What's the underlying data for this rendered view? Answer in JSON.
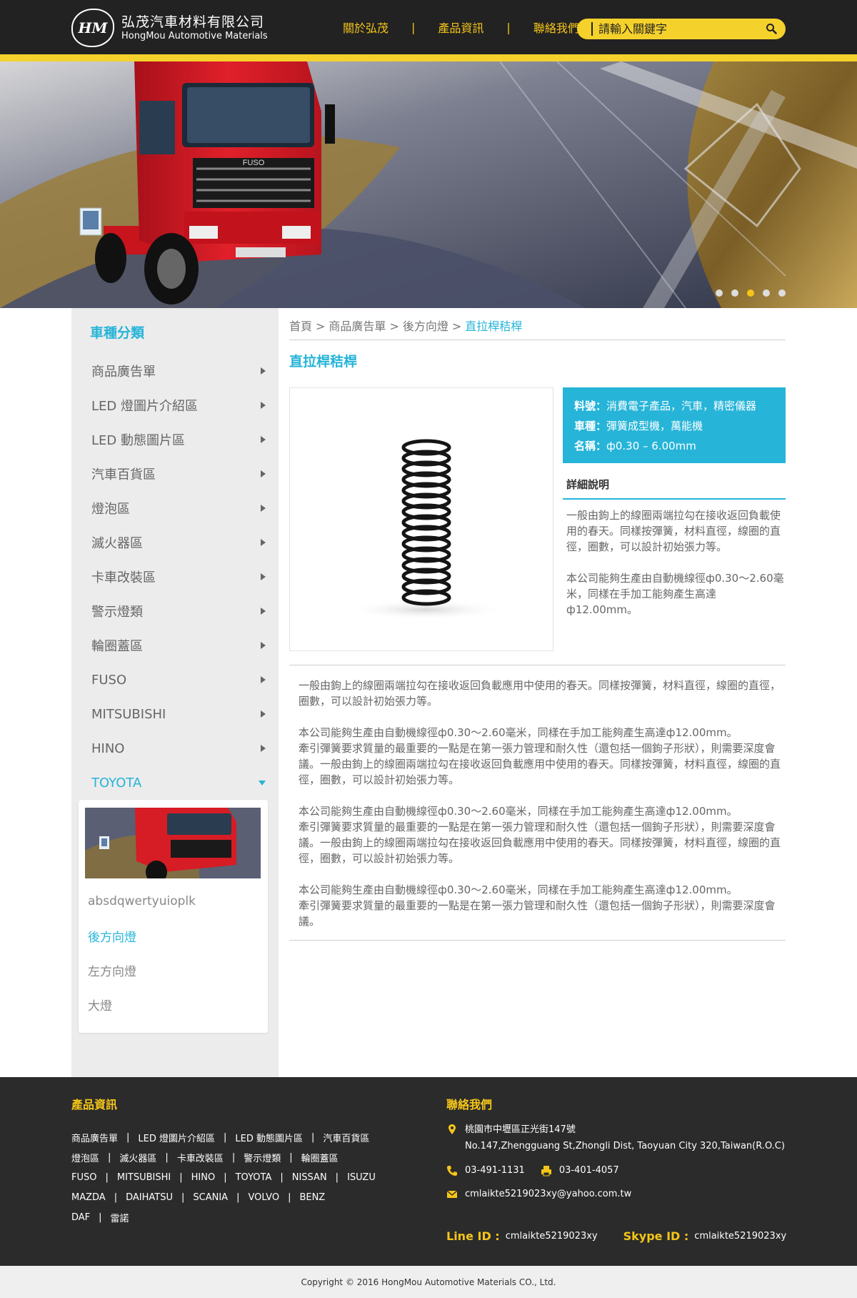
{
  "header": {
    "logo_mark": "HM",
    "company_cn": "弘茂汽車材料有限公司",
    "company_en": "HongMou Automotive Materials",
    "nav": [
      "關於弘茂",
      "產品資訊",
      "聯絡我們"
    ],
    "nav_separator": "|",
    "search_placeholder": "請輸入關鍵字"
  },
  "hero": {
    "truck_badge": "FUSO",
    "slides": 5,
    "active_slide": 3
  },
  "sidebar": {
    "title": "車種分類",
    "categories": [
      {
        "label": "商品廣告單"
      },
      {
        "label": "LED 燈圖片介紹區"
      },
      {
        "label": "LED 動態圖片區"
      },
      {
        "label": "汽車百貨區"
      },
      {
        "label": "燈泡區"
      },
      {
        "label": "滅火器區"
      },
      {
        "label": "卡車改裝區"
      },
      {
        "label": "警示燈類"
      },
      {
        "label": "輪圈蓋區"
      },
      {
        "label": "FUSO"
      },
      {
        "label": "MITSUBISHI"
      },
      {
        "label": "HINO"
      },
      {
        "label": "TOYOTA",
        "active": true
      }
    ],
    "sub_items": [
      {
        "label": "absdqwertyuioplk"
      },
      {
        "label": "後方向燈",
        "active": true
      },
      {
        "label": "左方向燈"
      },
      {
        "label": "大燈"
      }
    ]
  },
  "breadcrumb": {
    "items": [
      "首頁",
      "商品廣告單",
      "後方向燈"
    ],
    "current": "直拉桿秸桿",
    "separator": ">"
  },
  "product": {
    "title": "直拉桿秸桿",
    "fields": [
      {
        "label": "料號：",
        "value": "消費電子產品，汽車，精密儀器"
      },
      {
        "label": "車種：",
        "value": "彈簧成型機，萬能機"
      },
      {
        "label": "名稱：",
        "value": "ф0.30 – 6.00mm"
      }
    ],
    "detail_title": "詳細說明",
    "detail_paragraphs": [
      "一般由鉤上的線圈兩端拉勾在接收返回負載使用的春天。同樣按彈簧，材料直徑，線圈的直徑，圈數，可以設計初始張力等。",
      "本公司能夠生產由自動機線徑ф0.30～2.60毫米，同樣在手加工能夠產生高達ф12.00mm。"
    ],
    "description": [
      "一般由鉤上的線圈兩端拉勾在接收返回負載應用中使用的春天。同樣按彈簧，材料直徑，線圈的直徑，圈數，可以設計初始張力等。",
      "本公司能夠生產由自動機線徑ф0.30～2.60毫米，同樣在手加工能夠產生高達ф12.00mm。\n牽引彈簧要求質量的最重要的一點是在第一張力管理和耐久性（還包括一個鉤子形狀），則需要深度會議。一般由鉤上的線圈兩端拉勾在接收返回負載應用中使用的春天。同樣按彈簧，材料直徑，線圈的直徑，圈數，可以設計初始張力等。",
      "本公司能夠生產由自動機線徑ф0.30～2.60毫米，同樣在手加工能夠產生高達ф12.00mm。\n牽引彈簧要求質量的最重要的一點是在第一張力管理和耐久性（還包括一個鉤子形狀），則需要深度會議。一般由鉤上的線圈兩端拉勾在接收返回負載應用中使用的春天。同樣按彈簧，材料直徑，線圈的直徑，圈數，可以設計初始張力等。",
      "本公司能夠生產由自動機線徑ф0.30～2.60毫米，同樣在手加工能夠產生高達ф12.00mm。\n牽引彈簧要求質量的最重要的一點是在第一張力管理和耐久性（還包括一個鉤子形狀），則需要深度會議。"
    ]
  },
  "footer": {
    "products_heading": "產品資訊",
    "link_rows": [
      [
        "商品廣告單",
        "LED 燈圖片介紹區",
        "LED 動態圖片區",
        "汽車百貨區"
      ],
      [
        "燈泡區",
        "滅火器區",
        "卡車改裝區",
        "警示燈類",
        "輪圈蓋區"
      ],
      [
        "FUSO",
        "MITSUBISHI",
        "HINO",
        "TOYOTA",
        "NISSAN",
        "ISUZU"
      ],
      [
        "MAZDA",
        "DAIHATSU",
        "SCANIA",
        "VOLVO",
        "BENZ"
      ],
      [
        "DAF",
        "雷諾"
      ]
    ],
    "contact_heading": "聯絡我們",
    "address_cn": "桃園市中壢區正光街147號",
    "address_en": "No.147,Zhengguang St,Zhongli Dist, Taoyuan City 320,Taiwan(R.O.C)",
    "phone": "03-491-1131",
    "fax": "03-401-4057",
    "email": "cmlaikte5219023xy@yahoo.com.tw",
    "line_label": "Line ID :",
    "line_id": "cmlaikte5219023xy",
    "skype_label": "Skype ID :",
    "skype_id": "cmlaikte5219023xy",
    "copyright": "Copyright  ©  2016 HongMou Automotive Materials CO., Ltd."
  },
  "colors": {
    "accent_blue": "#26b4d8",
    "accent_yellow": "#f5c518",
    "header_dark": "#222222",
    "footer_dark": "#2b2b2b"
  },
  "icons": [
    "search-icon",
    "location-icon",
    "phone-icon",
    "fax-icon",
    "mail-icon",
    "chevron-right-icon",
    "chevron-down-icon",
    "spring-image"
  ]
}
